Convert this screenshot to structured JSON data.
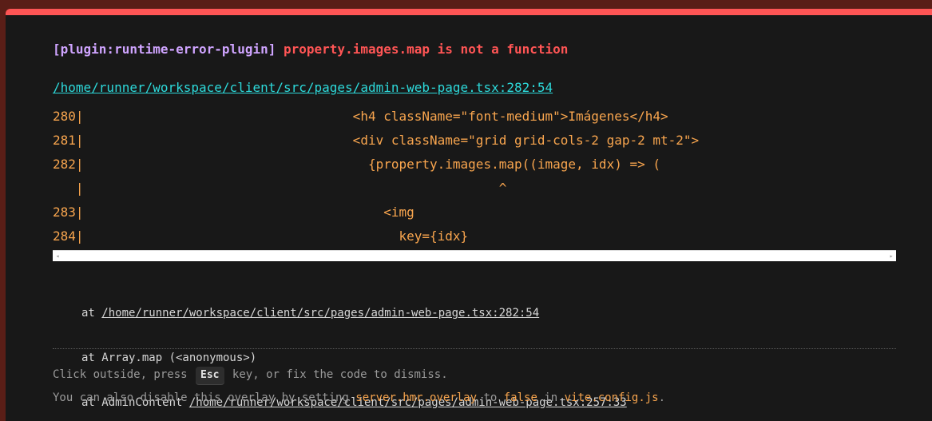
{
  "error": {
    "plugin": "[plugin:runtime-error-plugin]",
    "message": "property.images.map is not a function",
    "file": "/home/runner/workspace/client/src/pages/admin-web-page.tsx:282:54"
  },
  "frame_lines": [
    "280|                                   <h4 className=\"font-medium\">Imágenes</h4>",
    "281|                                   <div className=\"grid grid-cols-2 gap-2 mt-2\">",
    "282|                                     {property.images.map((image, idx) => (",
    "   |                                                      ^",
    "283|                                       <img",
    "284|                                         key={idx}"
  ],
  "scrollbar": {
    "left_arrow": "◂",
    "right_arrow": "▸"
  },
  "stack": [
    {
      "prefix": "at ",
      "link": "/home/runner/workspace/client/src/pages/admin-web-page.tsx:282:54"
    },
    {
      "prefix": "at Array.map (<anonymous>)",
      "link": ""
    },
    {
      "prefix": "at AdminContent ",
      "link": "/home/runner/workspace/client/src/pages/admin-web-page.tsx:257:33"
    }
  ],
  "tips": {
    "dismiss_before": "Click outside, press ",
    "dismiss_key": "Esc",
    "dismiss_after": " key, or fix the code to dismiss.",
    "disable_before": "You can also disable this overlay by setting ",
    "disable_setting": "server.hmr.overlay",
    "disable_mid": " to ",
    "disable_value": "false",
    "disable_in": " in ",
    "disable_file": "vite.config.js",
    "disable_end": "."
  },
  "colors": {
    "accent_border": "#ff5555",
    "plugin_text": "#cfa4ff",
    "error_text": "#ff5555",
    "file_link": "#2dd9da",
    "code_text": "#f8a54e"
  }
}
